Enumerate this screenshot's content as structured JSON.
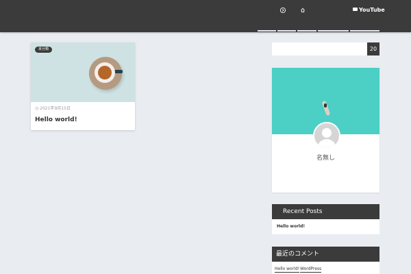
{
  "header": {
    "icons": [
      "instagram-icon",
      "home-icon"
    ],
    "youtube_label": "YouTube"
  },
  "post_card": {
    "category_tag": "未分類",
    "date": "2021年9月15日",
    "title": "Hello world!"
  },
  "search": {
    "value": "",
    "button_label": "20"
  },
  "profile": {
    "name": "名無し"
  },
  "recent_posts": {
    "title": "Recent Posts",
    "items": [
      "Hello world!"
    ]
  },
  "recent_comments": {
    "title": "最近のコメント",
    "items": [
      "Hello world!",
      "WordPress"
    ]
  },
  "colors": {
    "header_bg": "#3b3b3b",
    "page_bg": "#e9ecf0",
    "widget_title_bg": "#3b3b3b"
  }
}
